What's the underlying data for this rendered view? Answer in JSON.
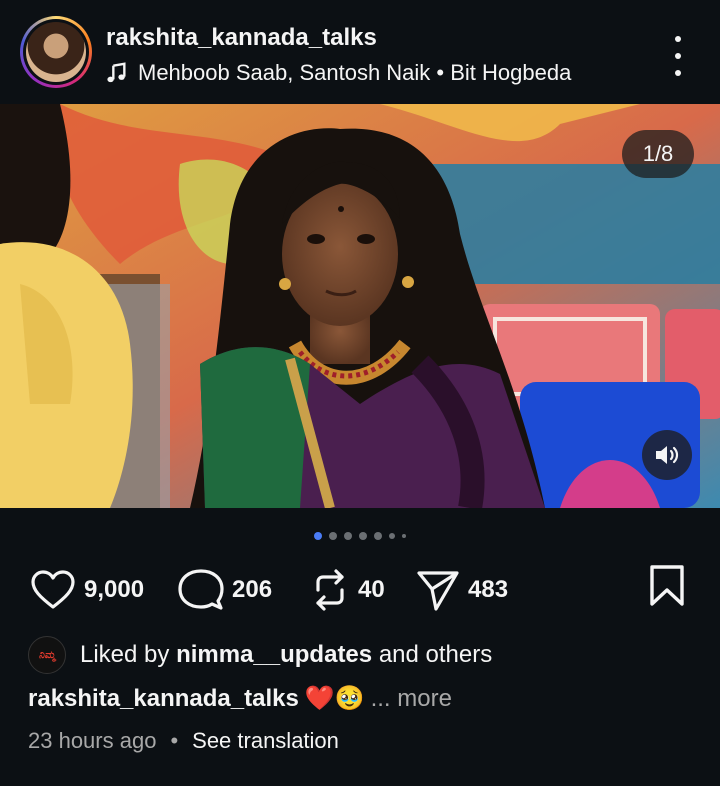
{
  "post": {
    "username": "rakshita_kannada_talks",
    "music": "Mehboob Saab, Santosh Naik • Bit Hogbeda",
    "icons": {
      "music": "music-note-icon",
      "more": "more-options-icon"
    }
  },
  "media": {
    "counter": "1/8",
    "total_slides": 8,
    "current_slide": 1,
    "icons": {
      "volume": "volume-icon"
    }
  },
  "actions": {
    "likes": "9,000",
    "comments": "206",
    "reposts": "40",
    "shares": "483",
    "icons": {
      "like": "heart-icon",
      "comment": "comment-icon",
      "repost": "repost-icon",
      "share": "send-icon",
      "save": "bookmark-icon"
    }
  },
  "liked_by": {
    "prefix": "Liked by",
    "user": "nimma__updates",
    "suffix": "and others"
  },
  "caption": {
    "username": "rakshita_kannada_talks",
    "emojis": "❤️🥹",
    "more": "... more"
  },
  "meta": {
    "time": "23 hours ago",
    "separator": "•",
    "translate": "See translation"
  }
}
